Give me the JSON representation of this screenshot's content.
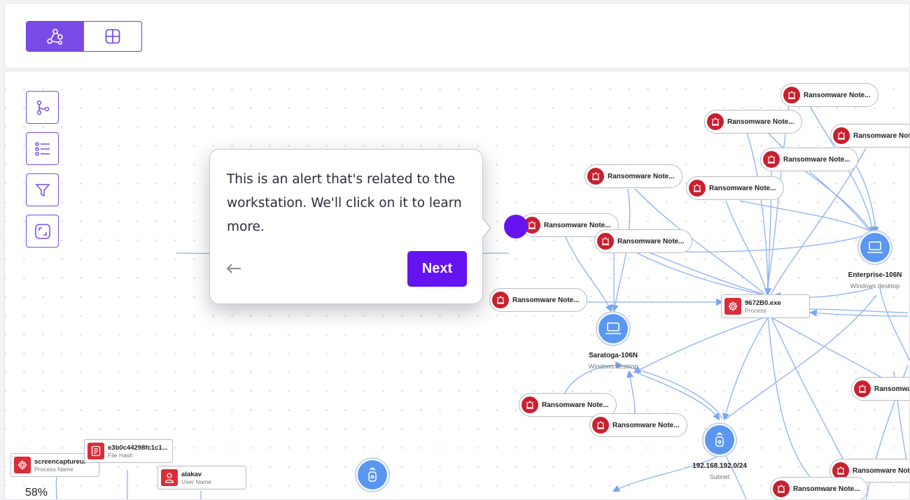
{
  "toolbar": {
    "view_toggle": [
      {
        "icon": "graph-view-icon",
        "active": true
      },
      {
        "icon": "table-view-icon",
        "active": false
      }
    ]
  },
  "side_tools": [
    "layout-tree-icon",
    "list-icon",
    "filter-icon",
    "fit-screen-icon"
  ],
  "tooltip": {
    "message": "This is an alert that's related to the workstation. We'll click on it to learn more.",
    "next_label": "Next",
    "back_icon": "arrow-left-icon"
  },
  "alerts": {
    "label_full": "Ransomware Note...",
    "label_cut": "Ransomwar"
  },
  "graph": {
    "process": {
      "title": "9672B0.exe",
      "subtitle": "Process"
    },
    "enterprise": {
      "title": "Enterprise-106N",
      "subtitle": "Windows desktop"
    },
    "saratoga": {
      "title": "Saratoga-106N",
      "subtitle": "Windows desktop"
    },
    "subnet": {
      "title": "192.168.192.0/24",
      "subtitle": "Subnet"
    },
    "screencapture": {
      "title": "screencaptureui",
      "subtitle": "Process Name"
    },
    "filehash": {
      "title": "e3b0c44298fc1c1...",
      "subtitle": "File Hash"
    },
    "user": {
      "title": "alakav",
      "subtitle": "User Name"
    }
  },
  "zoom_level": "58%",
  "colors": {
    "accent": "#6513f0",
    "alert_red": "#c8202f",
    "node_blue": "#5b97f1",
    "edge_blue": "#7fa9f2"
  }
}
